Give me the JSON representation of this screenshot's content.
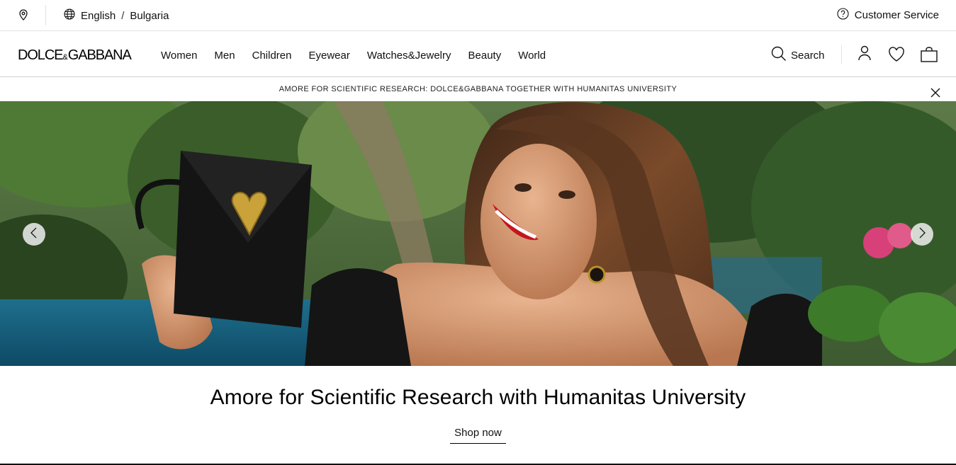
{
  "topbar": {
    "language": "English",
    "separator": "/",
    "country": "Bulgaria",
    "customer_service": "Customer Service"
  },
  "brand": {
    "part1": "DOLCE",
    "amp": "&",
    "part2": "GABBANA"
  },
  "nav": {
    "items": [
      "Women",
      "Men",
      "Children",
      "Eyewear",
      "Watches&Jewelry",
      "Beauty",
      "World"
    ],
    "search_label": "Search"
  },
  "announcement": {
    "text": "AMORE FOR SCIENTIFIC RESEARCH: DOLCE&GABBANA TOGETHER WITH HUMANITAS UNIVERSITY"
  },
  "hero": {
    "headline": "Amore for Scientific Research with Humanitas University",
    "cta": "Shop now"
  },
  "icons": {
    "location": "location-pin-icon",
    "globe": "globe-icon",
    "help": "question-circle-icon",
    "search": "search-icon",
    "account": "user-icon",
    "wishlist": "heart-icon",
    "bag": "shopping-bag-icon",
    "close": "close-icon",
    "prev": "chevron-left-icon",
    "next": "chevron-right-icon"
  },
  "colors": {
    "text": "#111111",
    "border": "#e2e2e2",
    "lipstick": "#c4161c"
  }
}
